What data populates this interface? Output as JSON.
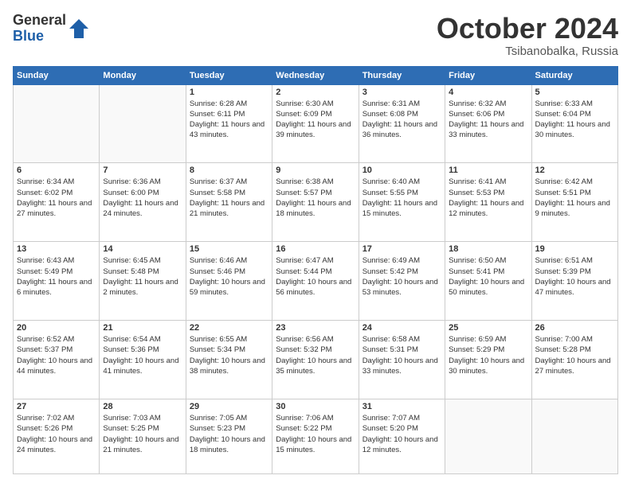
{
  "logo": {
    "general": "General",
    "blue": "Blue"
  },
  "header": {
    "month": "October 2024",
    "location": "Tsibanobalka, Russia"
  },
  "weekdays": [
    "Sunday",
    "Monday",
    "Tuesday",
    "Wednesday",
    "Thursday",
    "Friday",
    "Saturday"
  ],
  "weeks": [
    [
      {
        "day": "",
        "info": ""
      },
      {
        "day": "",
        "info": ""
      },
      {
        "day": "1",
        "info": "Sunrise: 6:28 AM\nSunset: 6:11 PM\nDaylight: 11 hours and 43 minutes."
      },
      {
        "day": "2",
        "info": "Sunrise: 6:30 AM\nSunset: 6:09 PM\nDaylight: 11 hours and 39 minutes."
      },
      {
        "day": "3",
        "info": "Sunrise: 6:31 AM\nSunset: 6:08 PM\nDaylight: 11 hours and 36 minutes."
      },
      {
        "day": "4",
        "info": "Sunrise: 6:32 AM\nSunset: 6:06 PM\nDaylight: 11 hours and 33 minutes."
      },
      {
        "day": "5",
        "info": "Sunrise: 6:33 AM\nSunset: 6:04 PM\nDaylight: 11 hours and 30 minutes."
      }
    ],
    [
      {
        "day": "6",
        "info": "Sunrise: 6:34 AM\nSunset: 6:02 PM\nDaylight: 11 hours and 27 minutes."
      },
      {
        "day": "7",
        "info": "Sunrise: 6:36 AM\nSunset: 6:00 PM\nDaylight: 11 hours and 24 minutes."
      },
      {
        "day": "8",
        "info": "Sunrise: 6:37 AM\nSunset: 5:58 PM\nDaylight: 11 hours and 21 minutes."
      },
      {
        "day": "9",
        "info": "Sunrise: 6:38 AM\nSunset: 5:57 PM\nDaylight: 11 hours and 18 minutes."
      },
      {
        "day": "10",
        "info": "Sunrise: 6:40 AM\nSunset: 5:55 PM\nDaylight: 11 hours and 15 minutes."
      },
      {
        "day": "11",
        "info": "Sunrise: 6:41 AM\nSunset: 5:53 PM\nDaylight: 11 hours and 12 minutes."
      },
      {
        "day": "12",
        "info": "Sunrise: 6:42 AM\nSunset: 5:51 PM\nDaylight: 11 hours and 9 minutes."
      }
    ],
    [
      {
        "day": "13",
        "info": "Sunrise: 6:43 AM\nSunset: 5:49 PM\nDaylight: 11 hours and 6 minutes."
      },
      {
        "day": "14",
        "info": "Sunrise: 6:45 AM\nSunset: 5:48 PM\nDaylight: 11 hours and 2 minutes."
      },
      {
        "day": "15",
        "info": "Sunrise: 6:46 AM\nSunset: 5:46 PM\nDaylight: 10 hours and 59 minutes."
      },
      {
        "day": "16",
        "info": "Sunrise: 6:47 AM\nSunset: 5:44 PM\nDaylight: 10 hours and 56 minutes."
      },
      {
        "day": "17",
        "info": "Sunrise: 6:49 AM\nSunset: 5:42 PM\nDaylight: 10 hours and 53 minutes."
      },
      {
        "day": "18",
        "info": "Sunrise: 6:50 AM\nSunset: 5:41 PM\nDaylight: 10 hours and 50 minutes."
      },
      {
        "day": "19",
        "info": "Sunrise: 6:51 AM\nSunset: 5:39 PM\nDaylight: 10 hours and 47 minutes."
      }
    ],
    [
      {
        "day": "20",
        "info": "Sunrise: 6:52 AM\nSunset: 5:37 PM\nDaylight: 10 hours and 44 minutes."
      },
      {
        "day": "21",
        "info": "Sunrise: 6:54 AM\nSunset: 5:36 PM\nDaylight: 10 hours and 41 minutes."
      },
      {
        "day": "22",
        "info": "Sunrise: 6:55 AM\nSunset: 5:34 PM\nDaylight: 10 hours and 38 minutes."
      },
      {
        "day": "23",
        "info": "Sunrise: 6:56 AM\nSunset: 5:32 PM\nDaylight: 10 hours and 35 minutes."
      },
      {
        "day": "24",
        "info": "Sunrise: 6:58 AM\nSunset: 5:31 PM\nDaylight: 10 hours and 33 minutes."
      },
      {
        "day": "25",
        "info": "Sunrise: 6:59 AM\nSunset: 5:29 PM\nDaylight: 10 hours and 30 minutes."
      },
      {
        "day": "26",
        "info": "Sunrise: 7:00 AM\nSunset: 5:28 PM\nDaylight: 10 hours and 27 minutes."
      }
    ],
    [
      {
        "day": "27",
        "info": "Sunrise: 7:02 AM\nSunset: 5:26 PM\nDaylight: 10 hours and 24 minutes."
      },
      {
        "day": "28",
        "info": "Sunrise: 7:03 AM\nSunset: 5:25 PM\nDaylight: 10 hours and 21 minutes."
      },
      {
        "day": "29",
        "info": "Sunrise: 7:05 AM\nSunset: 5:23 PM\nDaylight: 10 hours and 18 minutes."
      },
      {
        "day": "30",
        "info": "Sunrise: 7:06 AM\nSunset: 5:22 PM\nDaylight: 10 hours and 15 minutes."
      },
      {
        "day": "31",
        "info": "Sunrise: 7:07 AM\nSunset: 5:20 PM\nDaylight: 10 hours and 12 minutes."
      },
      {
        "day": "",
        "info": ""
      },
      {
        "day": "",
        "info": ""
      }
    ]
  ]
}
